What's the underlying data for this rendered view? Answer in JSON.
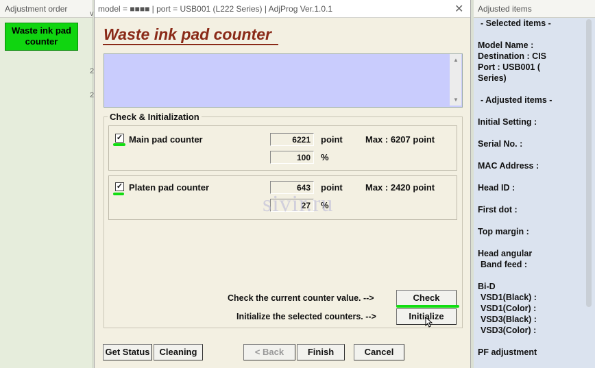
{
  "left": {
    "header": "Adjustment order",
    "item": "Waste ink pad counter",
    "item_line1": "Waste ink pad",
    "item_line2": "counter"
  },
  "window": {
    "title": "model = ■■■■ | port = USB001 (L222 Series) | AdjProg Ver.1.0.1",
    "close": "✕"
  },
  "page_title": "Waste ink pad counter",
  "group_title": "Check & Initialization",
  "main_pad": {
    "label": "Main pad counter",
    "checked": true,
    "value": "6221",
    "unit": "point",
    "max": "Max : 6207 point",
    "percent": "100",
    "percent_unit": "%"
  },
  "platen_pad": {
    "label": "Platen pad counter",
    "checked": true,
    "value": "643",
    "unit": "point",
    "max": "Max : 2420 point",
    "percent": "27",
    "percent_unit": "%"
  },
  "actions": {
    "check_text": "Check the current counter value. -->",
    "check_button": "Check",
    "init_text": "Initialize the selected counters. -->",
    "init_button": "Initialize"
  },
  "footer": {
    "get_status": "Get Status",
    "cleaning": "Cleaning",
    "back": "< Back",
    "finish": "Finish",
    "cancel": "Cancel"
  },
  "watermark": "sivir.ru",
  "right": {
    "header": "Adjusted items",
    "selected_heading": "- Selected items -",
    "model_name": "Model Name :",
    "destination": "Destination : CIS",
    "port": "Port : USB001 (",
    "series": "Series)",
    "adjusted_heading": "- Adjusted items -",
    "items": [
      "Initial Setting :",
      "Serial No. :",
      "MAC Address :",
      "Head ID :",
      "First dot :",
      "Top margin :",
      "Head angular",
      "Band feed :",
      "Bi-D",
      "VSD1(Black) :",
      "VSD1(Color) :",
      "VSD3(Black) :",
      "VSD3(Color) :",
      "PF adjustment"
    ]
  },
  "colors": {
    "accent_green": "#10d510",
    "title_brown": "#8a2a18",
    "info_box": "#c9ccfd"
  }
}
